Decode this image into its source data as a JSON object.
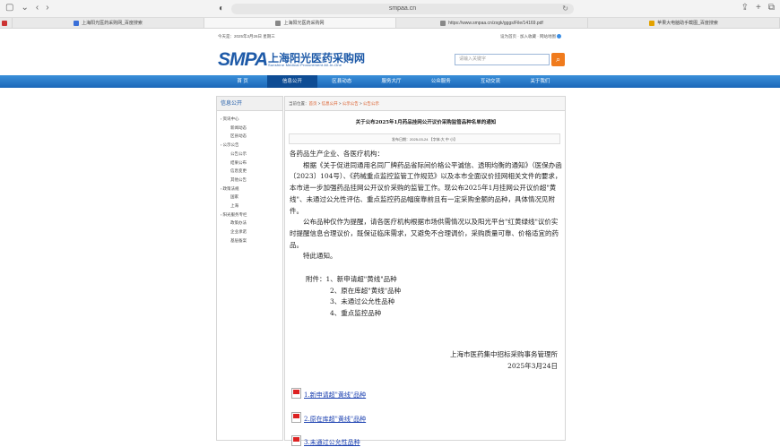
{
  "browser": {
    "url": "smpaa.cn",
    "tabs": [
      {
        "label": "上海阳光医药采购网_百度搜索",
        "active": false
      },
      {
        "label": "上海阳光医药采购网",
        "active": true
      },
      {
        "label": "https://www.smpaa.cn/zxgk/gggs/File/14169.pdf",
        "active": false
      },
      {
        "label": "苹果大电脑助手截图_百度搜索",
        "active": false
      }
    ]
  },
  "topstrip": {
    "date": "今天是：2025年3月26日 星期三",
    "links": "设为首页 · 加入收藏 · 网站地图"
  },
  "header": {
    "logo_abbr": "SMPA",
    "logo_cn": "上海阳光医药采购网",
    "logo_en": "Sunshine Medical Procurement All-In-One",
    "search_placeholder": "请输入关键字",
    "search_icon": "search-icon"
  },
  "nav": [
    {
      "label": "首 页",
      "active": false
    },
    {
      "label": "信息公开",
      "active": true
    },
    {
      "label": "区县动态",
      "active": false
    },
    {
      "label": "服务大厅",
      "active": false
    },
    {
      "label": "公众服务",
      "active": false
    },
    {
      "label": "互动交流",
      "active": false
    },
    {
      "label": "关于我们",
      "active": false
    }
  ],
  "sidebar": {
    "title": "信息公开",
    "items": [
      {
        "label": "资讯中心",
        "level": 1
      },
      {
        "label": "新闻动态",
        "level": 2
      },
      {
        "label": "区县动态",
        "level": 2
      },
      {
        "label": "公示公告",
        "level": 1
      },
      {
        "label": "公告公示",
        "level": 2
      },
      {
        "label": "结果公布",
        "level": 2
      },
      {
        "label": "信息变更",
        "level": 2
      },
      {
        "label": "其他公告",
        "level": 2
      },
      {
        "label": "政策法规",
        "level": 1
      },
      {
        "label": "国家",
        "level": 2
      },
      {
        "label": "上海",
        "level": 2
      },
      {
        "label": "阳光服务专栏",
        "level": 1
      },
      {
        "label": "政策办法",
        "level": 2
      },
      {
        "label": "企业承诺",
        "level": 2
      },
      {
        "label": "基层备案",
        "level": 2
      }
    ]
  },
  "breadcrumb": {
    "prefix": "当前位置：",
    "items": [
      "首页",
      "信息公开",
      "公示公告",
      "公告公示"
    ],
    "sep": " > "
  },
  "article": {
    "title": "关于公布2025年1月药品挂网公开议价采购监管品种名单的通知",
    "publish": "发布日期：2025-03-24 【字体:大 中 小】",
    "salutation": "各药品生产企业、各医疗机构：",
    "para1": "根据《关于促进同通用名同厂牌药品省际间价格公平诚信、透明均衡的通知》（医保办函〔2023〕104号）、《药械重点监控监管工作规范》以及本市全面议价挂网相关文件的要求，本市进一步加强药品挂网公开议价采购的监管工作。现公布2025年1月挂网公开议价超\"黄线\"、未通过公允性评估、重点监控药品幅度靠前且有一定采购金额的品种，具体情况见附件。",
    "para2": "公布品种仅作为提醒，请各医疗机构根据市场供需情况以及阳光平台\"红黄绿线\"议价实时提醒信息合理议价，既保证临床需求，又避免不合理调价，采购质量可靠、价格适宜的药品。",
    "para3": "特此通知。",
    "attach_prefix": "附件：",
    "attachments": [
      "1、新申请超\"黄线\"品种",
      "2、原在库超\"黄线\"品种",
      "3、未通过公允性品种",
      "4、重点监控品种"
    ],
    "org": "上海市医药集中招标采购事务管理所",
    "date": "2025年3月24日",
    "links": [
      "1.新申请超\"黄线\"品种",
      "2.原在库超\"黄线\"品种",
      "3.未通过公允性品种"
    ]
  }
}
